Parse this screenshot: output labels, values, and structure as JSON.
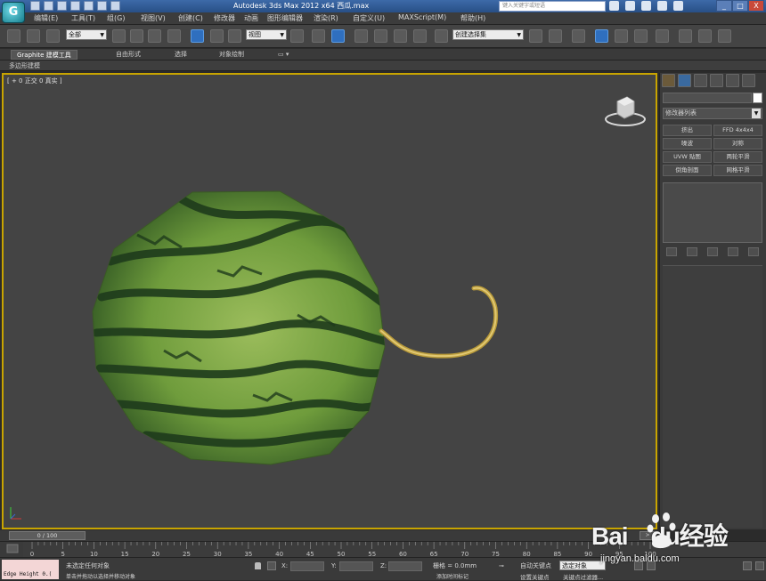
{
  "titlebar": {
    "logo": "G",
    "title": "Autodesk 3ds Max  2012 x64      西瓜.max",
    "search_placeholder": "键入关键字或短语",
    "controls": [
      "_",
      "□",
      "X"
    ]
  },
  "menubar": {
    "items": [
      "编辑(E)",
      "工具(T)",
      "组(G)",
      "视图(V)",
      "创建(C)",
      "修改器",
      "动画",
      "图形编辑器",
      "渲染(R)",
      "自定义(U)",
      "MAXScript(M)",
      "帮助(H)"
    ]
  },
  "toolbar": {
    "selection_filter": "全部",
    "reference_coord": "视图",
    "named_selection": "创建选择集"
  },
  "ribbon": {
    "tabs": [
      "Graphite 建模工具",
      "自由形式",
      "选择",
      "对象绘制"
    ],
    "active_tab": "Graphite 建模工具",
    "sub_label": "多边形建模"
  },
  "viewport": {
    "label": "[ + 0 正交 0 真实 ]",
    "border_color": "#c8a400"
  },
  "command_panel": {
    "modifier_list": "修改器列表",
    "buttons": [
      "挤出",
      "FFD 4x4x4",
      "噪波",
      "对称",
      "UVW 贴图",
      "两轮平滑",
      "倒角剖面",
      "网格平滑"
    ]
  },
  "timeline": {
    "position": "0 / 100",
    "ticks": [
      "0",
      "5",
      "10",
      "15",
      "20",
      "25",
      "30",
      "35",
      "40",
      "45",
      "50",
      "55",
      "60",
      "65",
      "70",
      "75",
      "80",
      "85",
      "90",
      "95",
      "100"
    ]
  },
  "status": {
    "maxscript_text": "Edge Height 0.(",
    "line1": "未选定任何对象",
    "line2": "单击并拖动以选择并移动对象",
    "x_label": "X:",
    "y_label": "Y:",
    "z_label": "Z:",
    "grid": "栅格 = 0.0mm",
    "add_time_tag": "添加时间标记",
    "auto_key": "自动关键点",
    "set_key": "设置关键点",
    "selected_object": "选定对象",
    "key_filters": "关键点过滤器..."
  },
  "watermark": {
    "brand_a": "Bai",
    "brand_b": "du",
    "brand_c": "经验",
    "sub": "jingyan.baidu.com"
  }
}
